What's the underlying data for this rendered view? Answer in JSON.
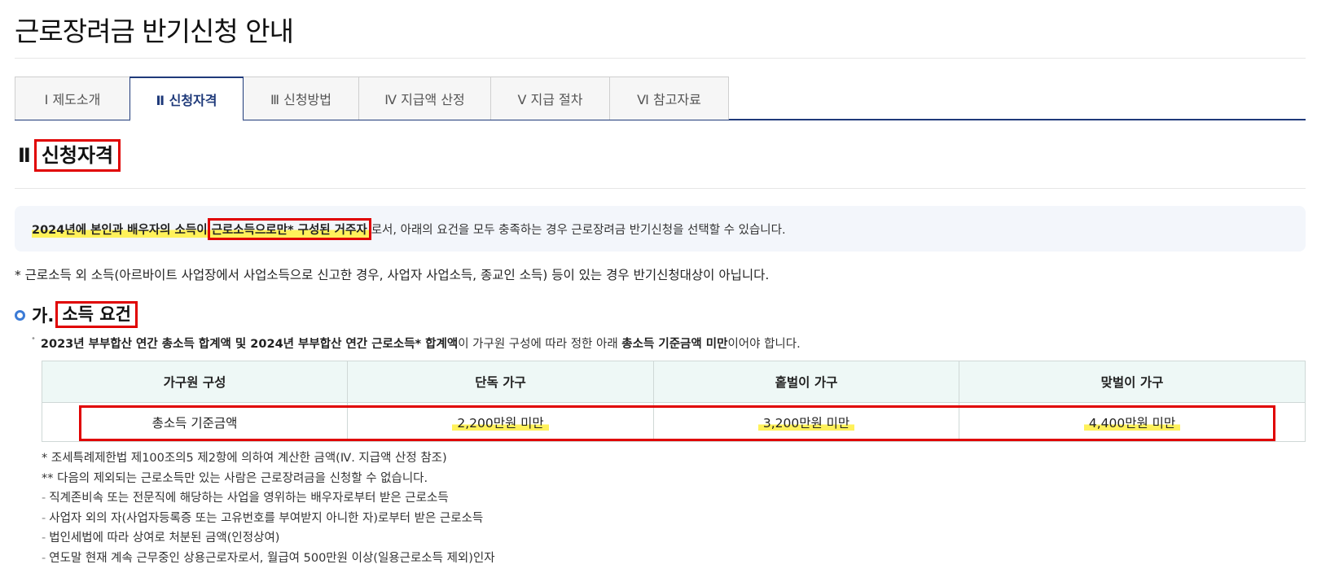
{
  "page": {
    "title": "근로장려금 반기신청 안내"
  },
  "tabs": [
    {
      "label": "Ⅰ  제도소개",
      "active": false
    },
    {
      "label": "Ⅱ  신청자격",
      "active": true
    },
    {
      "label": "Ⅲ  신청방법",
      "active": false
    },
    {
      "label": "Ⅳ  지급액 산정",
      "active": false
    },
    {
      "label": "Ⅴ  지급 절차",
      "active": false
    },
    {
      "label": "Ⅵ  참고자료",
      "active": false
    }
  ],
  "section": {
    "number": "Ⅱ",
    "title": "신청자격"
  },
  "notice": {
    "part1": "2024년에 본인과 배우자의 소득이 ",
    "part2": "근로소득으로만* 구성된 거주자",
    "part3": "로서, 아래의 요건을 모두 충족하는 경우 근로장려금 반기신청을 선택할 수 있습니다."
  },
  "footnote": "* 근로소득 외 소득(아르바이트 사업장에서 사업소득으로 신고한 경우, 사업자 사업소득, 종교인 소득) 등이 있는 경우 반기신청대상이 아닙니다.",
  "subsection": {
    "prefix": "가.",
    "title": "소득 요건"
  },
  "description": {
    "bold1": "2023년 부부합산 연간 총소득 합계액 및 2024년 부부합산 연간 근로소득* 합계액",
    "text1": "이 가구원 구성에 따라 정한 아래 ",
    "bold2": "총소득 기준금액 미만",
    "text2": "이어야 합니다."
  },
  "table": {
    "headers": [
      "가구원 구성",
      "단독 가구",
      "홑벌이 가구",
      "맞벌이 가구"
    ],
    "row": [
      "총소득 기준금액",
      "2,200만원 미만",
      "3,200만원 미만",
      "4,400만원 미만"
    ]
  },
  "notes": [
    "* 조세특례제한법 제100조의5 제2항에 의하여 계산한 금액(Ⅳ. 지급액 산정 참조)",
    "** 다음의 제외되는 근로소득만 있는 사람은 근로장려금을 신청할 수 없습니다.",
    "직계존비속 또는 전문직에 해당하는 사업을 영위하는 배우자로부터 받은 근로소득",
    "사업자 외의 자(사업자등록증 또는 고유번호를 부여받지 아니한 자)로부터 받은 근로소득",
    "법인세법에 따라 상여로 처분된 금액(인정상여)",
    "연도말 현재 계속 근무중인 상용근로자로서, 월급여 500만원 이상(일용근로소득 제외)인자"
  ],
  "colors": {
    "accent": "#1f3a7a",
    "highlight": "#fff15a",
    "annotation": "#e00000",
    "table_header": "#eef8f6"
  }
}
